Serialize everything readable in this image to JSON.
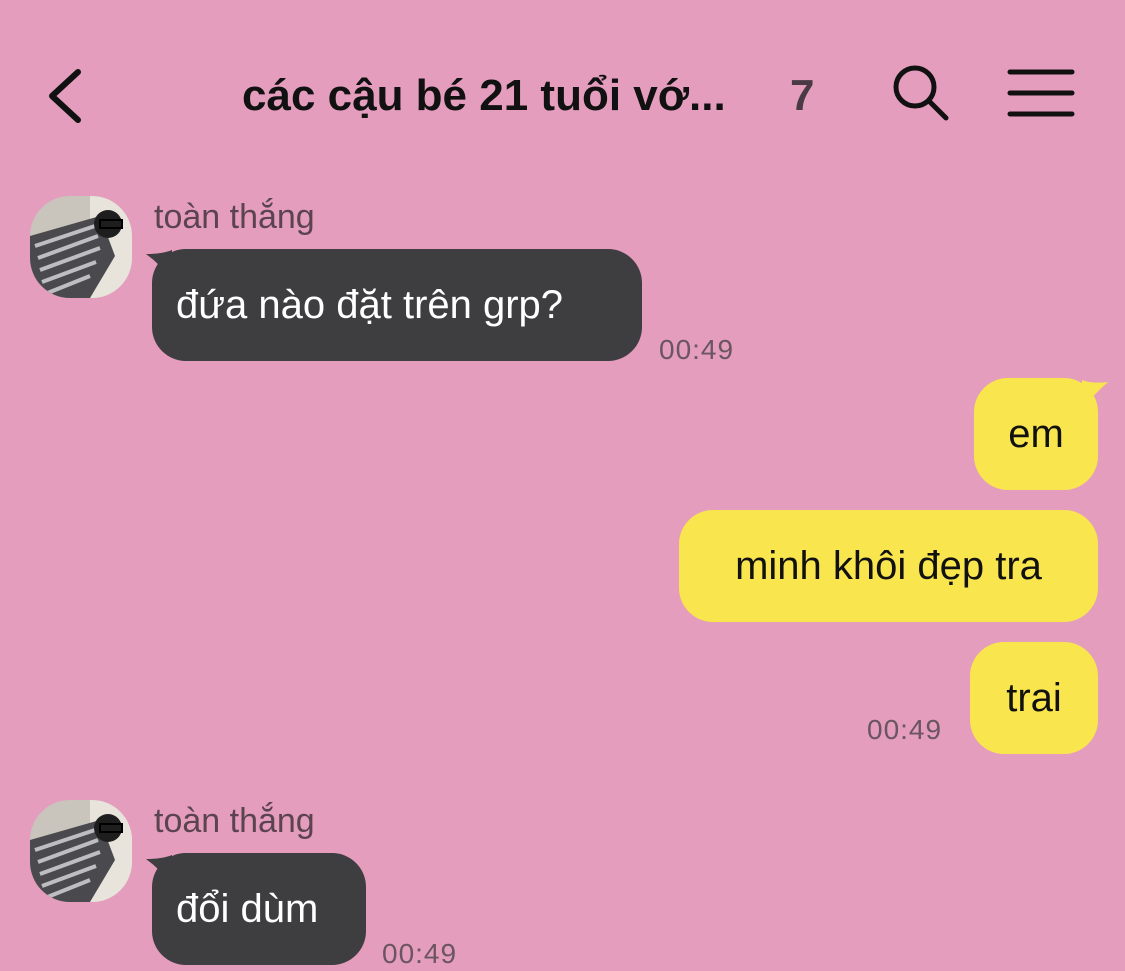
{
  "header": {
    "title": "các cậu bé 21 tuổi vớ...",
    "member_count": "7",
    "icons": [
      "chevron-left-icon",
      "search-icon",
      "menu-icon"
    ]
  },
  "messages": [
    {
      "sender": "toàn thắng",
      "text": "đứa nào đặt trên grp?",
      "time": "00:49",
      "direction": "incoming"
    },
    {
      "text": "em",
      "direction": "outgoing"
    },
    {
      "text": "minh khôi đẹp tra",
      "direction": "outgoing"
    },
    {
      "text": "trai",
      "time": "00:49",
      "direction": "outgoing"
    },
    {
      "sender": "toàn thắng",
      "text": "đổi dùm",
      "time": "00:49",
      "direction": "incoming"
    }
  ],
  "colors": {
    "background": "#E59DBE",
    "incoming_bubble": "#3E3D40",
    "outgoing_bubble": "#F9E54D"
  }
}
